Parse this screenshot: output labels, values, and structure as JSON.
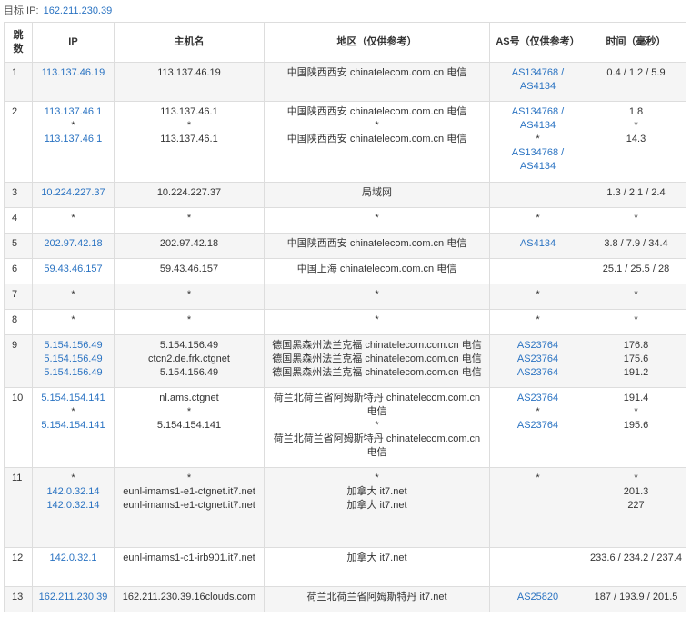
{
  "target": {
    "label": "目标 IP:",
    "ip": "162.211.230.39"
  },
  "headers": {
    "hop": "跳数",
    "ip": "IP",
    "host": "主机名",
    "region": "地区（仅供参考）",
    "as": "AS号（仅供参考）",
    "time": "时间（毫秒）"
  },
  "rows": [
    {
      "hop": "1",
      "ip": [
        "113.137.46.19"
      ],
      "host": [
        "113.137.46.19"
      ],
      "region": [
        "中国陕西西安 chinatelecom.com.cn 电信"
      ],
      "as": [
        "AS134768 / AS4134"
      ],
      "time": [
        "0.4 / 1.2 / 5.9"
      ]
    },
    {
      "hop": "2",
      "ip": [
        "113.137.46.1",
        "*",
        "113.137.46.1"
      ],
      "host": [
        "113.137.46.1",
        "*",
        "113.137.46.1"
      ],
      "region": [
        "中国陕西西安 chinatelecom.com.cn 电信",
        "*",
        "中国陕西西安 chinatelecom.com.cn 电信"
      ],
      "as": [
        "AS134768 / AS4134",
        "*",
        "AS134768 / AS4134"
      ],
      "time": [
        "1.8",
        "*",
        "14.3"
      ]
    },
    {
      "hop": "3",
      "ip": [
        "10.224.227.37"
      ],
      "host": [
        "10.224.227.37"
      ],
      "region": [
        "局域网"
      ],
      "as": [],
      "time": [
        "1.3 / 2.1 / 2.4"
      ]
    },
    {
      "hop": "4",
      "ip": [
        "*"
      ],
      "host": [
        "*"
      ],
      "region": [
        "*"
      ],
      "as": [
        "*"
      ],
      "time": [
        "*"
      ]
    },
    {
      "hop": "5",
      "ip": [
        "202.97.42.18"
      ],
      "host": [
        "202.97.42.18"
      ],
      "region": [
        "中国陕西西安 chinatelecom.com.cn 电信"
      ],
      "as": [
        "AS4134"
      ],
      "time": [
        "3.8 / 7.9 / 34.4"
      ]
    },
    {
      "hop": "6",
      "ip": [
        "59.43.46.157"
      ],
      "host": [
        "59.43.46.157"
      ],
      "region": [
        "中国上海 chinatelecom.com.cn 电信"
      ],
      "as": [],
      "time": [
        "25.1 / 25.5 / 28"
      ]
    },
    {
      "hop": "7",
      "ip": [
        "*"
      ],
      "host": [
        "*"
      ],
      "region": [
        "*"
      ],
      "as": [
        "*"
      ],
      "time": [
        "*"
      ]
    },
    {
      "hop": "8",
      "ip": [
        "*"
      ],
      "host": [
        "*"
      ],
      "region": [
        "*"
      ],
      "as": [
        "*"
      ],
      "time": [
        "*"
      ]
    },
    {
      "hop": "9",
      "ip": [
        "5.154.156.49",
        "5.154.156.49",
        "5.154.156.49"
      ],
      "host": [
        "5.154.156.49",
        "ctcn2.de.frk.ctgnet",
        "5.154.156.49"
      ],
      "region": [
        "德国黑森州法兰克福 chinatelecom.com.cn 电信",
        "德国黑森州法兰克福 chinatelecom.com.cn 电信",
        "德国黑森州法兰克福 chinatelecom.com.cn 电信"
      ],
      "as": [
        "AS23764",
        "AS23764",
        "AS23764"
      ],
      "time": [
        "176.8",
        "175.6",
        "191.2"
      ]
    },
    {
      "hop": "10",
      "ip": [
        "5.154.154.141",
        "*",
        "5.154.154.141"
      ],
      "host": [
        "nl.ams.ctgnet",
        "*",
        "5.154.154.141"
      ],
      "region": [
        "荷兰北荷兰省阿姆斯特丹 chinatelecom.com.cn 电信",
        "*",
        "荷兰北荷兰省阿姆斯特丹 chinatelecom.com.cn 电信"
      ],
      "as": [
        "AS23764",
        "*",
        "AS23764"
      ],
      "time": [
        "191.4",
        "*",
        "195.6"
      ]
    },
    {
      "hop": "11",
      "ip": [
        "*",
        "142.0.32.14",
        "142.0.32.14"
      ],
      "host": [
        "*",
        "eunl-imams1-e1-ctgnet.it7.net",
        "eunl-imams1-e1-ctgnet.it7.net"
      ],
      "region": [
        "*",
        "加拿大 it7.net",
        "加拿大 it7.net"
      ],
      "as": [
        "*"
      ],
      "time": [
        "*",
        "201.3",
        "227"
      ]
    },
    {
      "hop": "12",
      "ip": [
        "142.0.32.1"
      ],
      "host": [
        "eunl-imams1-c1-irb901.it7.net"
      ],
      "region": [
        "加拿大 it7.net"
      ],
      "as": [],
      "time": [
        "233.6 / 234.2 / 237.4"
      ]
    },
    {
      "hop": "13",
      "ip": [
        "162.211.230.39"
      ],
      "host": [
        "162.211.230.39.16clouds.com"
      ],
      "region": [
        "荷兰北荷兰省阿姆斯特丹 it7.net"
      ],
      "as": [
        "AS25820"
      ],
      "time": [
        "187 / 193.9 / 201.5"
      ]
    }
  ]
}
